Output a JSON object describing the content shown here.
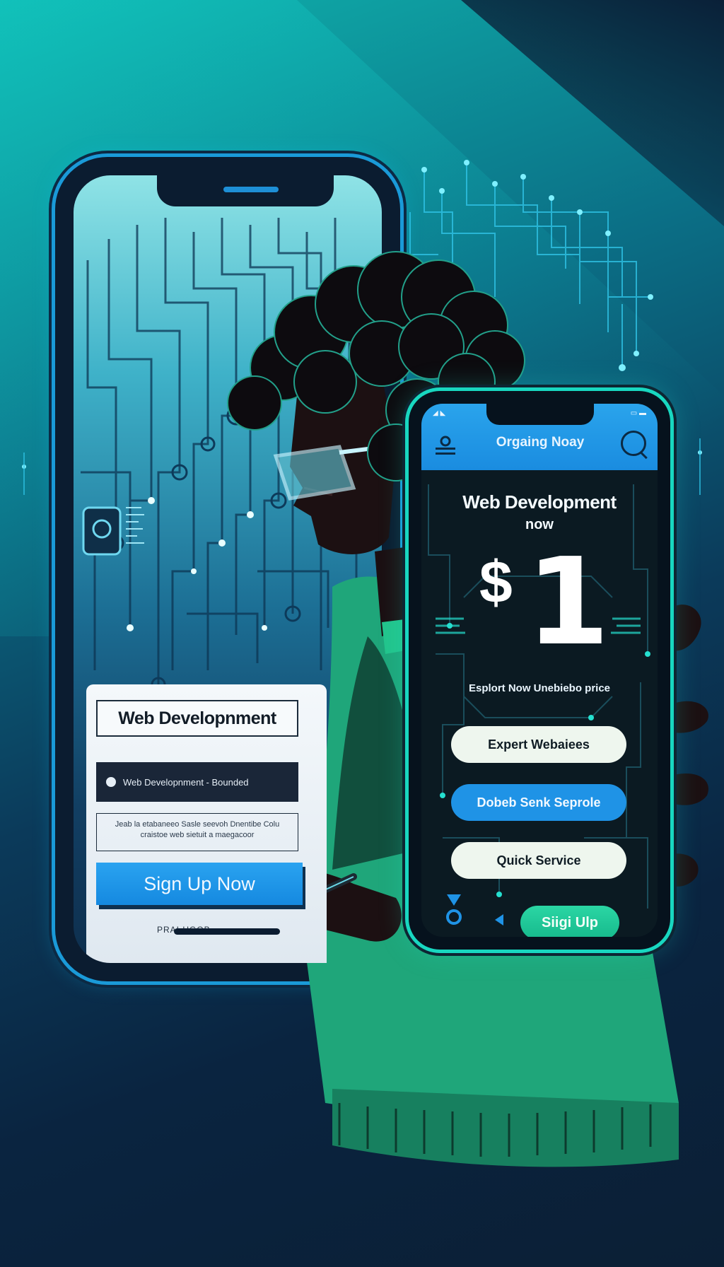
{
  "left_phone": {
    "card_title": "Web Developnment",
    "input_text": "Web Developnment - Bounded",
    "body_text": "Jeab la etabaneeo Sasle seevoh Dnentibe Colu craistoe web sietuit a maegacoor",
    "cta_label": "Sign Up Now",
    "footer_text": "PRAI UGOB"
  },
  "right_phone": {
    "status_left": "◢ ◣",
    "status_right": "▭ ▬",
    "header_title": "Orgaing Noay",
    "headline": "Web Development",
    "headline_sub": "now",
    "price_symbol": "$",
    "price_value": "1",
    "tagline": "Esplort Now Unebiebo price",
    "pills": [
      {
        "label": "Expert Webaiees",
        "style": "white"
      },
      {
        "label": "Dobeb Senk Seprole",
        "style": "blue"
      },
      {
        "label": "Quick Service",
        "style": "white"
      }
    ],
    "signup_label": "Siigi Ulp"
  },
  "colors": {
    "bg_teal": "#0fb3ad",
    "bg_navy": "#0b1f35",
    "accent_blue": "#1f93e6",
    "accent_green": "#16b98c",
    "frame_cyan": "#18d7c0"
  }
}
